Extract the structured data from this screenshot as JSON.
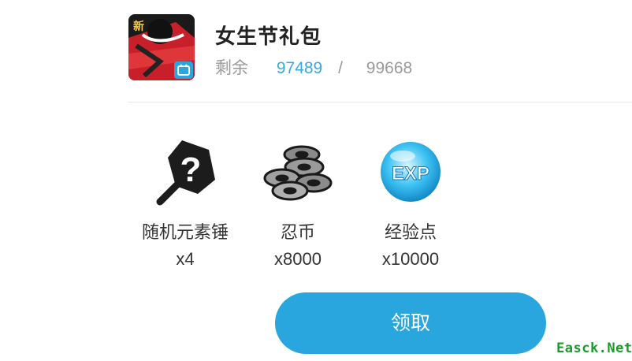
{
  "gift": {
    "title": "女生节礼包",
    "remain_label": "剩余",
    "remain_current": "97489",
    "remain_separator": "/",
    "remain_total": "99668"
  },
  "items": [
    {
      "name": "随机元素锤",
      "quantity": "x4",
      "icon": "mystery-hammer-icon"
    },
    {
      "name": "忍币",
      "quantity": "x8000",
      "icon": "ninja-coins-icon"
    },
    {
      "name": "经验点",
      "quantity": "x10000",
      "icon": "exp-orb-icon"
    }
  ],
  "icon_text": {
    "question_mark": "?",
    "exp": "EXP"
  },
  "claim_button": {
    "label": "领取"
  },
  "watermark": {
    "text": "Easck.Net"
  },
  "colors": {
    "accent": "#2aa6df",
    "remain_current": "#3aa8e0",
    "watermark": "#1a9a2a"
  }
}
